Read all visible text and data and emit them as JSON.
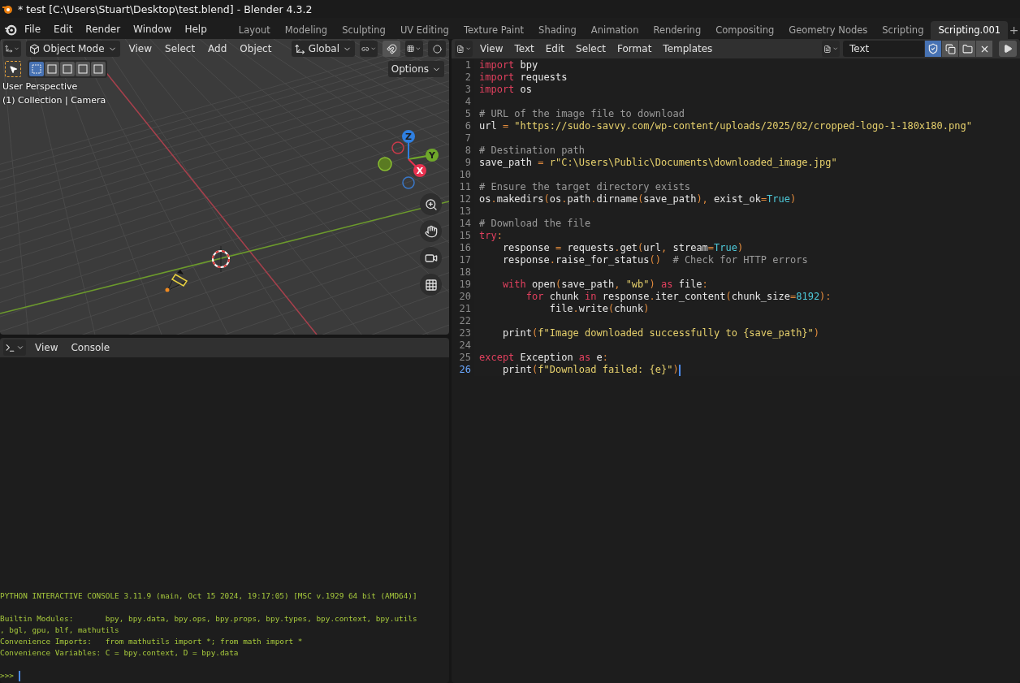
{
  "window": {
    "title": "* test [C:\\Users\\Stuart\\Desktop\\test.blend] - Blender 4.3.2"
  },
  "menu": [
    "File",
    "Edit",
    "Render",
    "Window",
    "Help"
  ],
  "workspace_tabs": [
    {
      "label": "Layout",
      "selected": false
    },
    {
      "label": "Modeling",
      "selected": false
    },
    {
      "label": "Sculpting",
      "selected": false
    },
    {
      "label": "UV Editing",
      "selected": false
    },
    {
      "label": "Texture Paint",
      "selected": false
    },
    {
      "label": "Shading",
      "selected": false
    },
    {
      "label": "Animation",
      "selected": false
    },
    {
      "label": "Rendering",
      "selected": false
    },
    {
      "label": "Compositing",
      "selected": false
    },
    {
      "label": "Geometry Nodes",
      "selected": false
    },
    {
      "label": "Scripting",
      "selected": false
    },
    {
      "label": "Scripting.001",
      "selected": true
    }
  ],
  "add_tab": "+",
  "viewport": {
    "mode": "Object Mode",
    "menus": [
      "View",
      "Select",
      "Add",
      "Object"
    ],
    "orientation": "Global",
    "snap_on": true,
    "select_modes": [
      {
        "selected": true
      },
      {
        "selected": false
      },
      {
        "selected": false
      },
      {
        "selected": false
      },
      {
        "selected": false
      }
    ],
    "options": "Options",
    "overlay": [
      "User Perspective",
      "(1) Collection | Camera"
    ],
    "gizmo": [
      {
        "label": "Z",
        "color": "#2f7fe0"
      },
      {
        "label": "Y",
        "color": "#6fa82a"
      },
      {
        "label": "X",
        "color": "#e8314f"
      }
    ]
  },
  "console": {
    "menus": [
      "View",
      "Console"
    ],
    "blocks": [
      [
        "PYTHON INTERACTIVE CONSOLE 3.11.9 (main, Oct 15 2024, 19:17:05) [MSC v.1929 64 bit (AMD64)]"
      ],
      [
        "Builtin Modules:       bpy, bpy.data, bpy.ops, bpy.props, bpy.types, bpy.context, bpy.utils",
        ", bgl, gpu, blf, mathutils",
        "Convenience Imports:   from mathutils import *; from math import *",
        "Convenience Variables: C = bpy.context, D = bpy.data"
      ]
    ],
    "prompt": ">>>"
  },
  "text_editor": {
    "menus": [
      "View",
      "Text",
      "Edit",
      "Select",
      "Format",
      "Templates"
    ],
    "datablock": "Text",
    "fake_user": true,
    "lines": [
      {
        "number": "1",
        "current": false,
        "tokens": [
          {
            "kind": "keyword",
            "text": "import"
          },
          {
            "kind": "plain",
            "text": " bpy"
          }
        ]
      },
      {
        "number": "2",
        "current": false,
        "tokens": [
          {
            "kind": "keyword",
            "text": "import"
          },
          {
            "kind": "plain",
            "text": " requests"
          }
        ]
      },
      {
        "number": "3",
        "current": false,
        "tokens": [
          {
            "kind": "keyword",
            "text": "import"
          },
          {
            "kind": "plain",
            "text": " os"
          }
        ]
      },
      {
        "number": "4",
        "current": false
      },
      {
        "number": "5",
        "current": false,
        "tokens": [
          {
            "kind": "comment",
            "text": "# URL of the image file to download"
          }
        ]
      },
      {
        "number": "6",
        "current": false,
        "tokens": [
          {
            "kind": "plain",
            "text": "url "
          },
          {
            "kind": "operator",
            "text": "="
          },
          {
            "kind": "string",
            "text": " \"https://sudo-savvy.com/wp-content/uploads/2025/02/cropped-logo-1-180x180.png\""
          }
        ]
      },
      {
        "number": "7",
        "current": false
      },
      {
        "number": "8",
        "current": false,
        "tokens": [
          {
            "kind": "comment",
            "text": "# Destination path"
          }
        ]
      },
      {
        "number": "9",
        "current": false,
        "tokens": [
          {
            "kind": "plain",
            "text": "save_path "
          },
          {
            "kind": "operator",
            "text": "="
          },
          {
            "kind": "string",
            "text": " r\"C:\\Users\\Public\\Documents\\downloaded_image.jpg\""
          }
        ]
      },
      {
        "number": "10",
        "current": false
      },
      {
        "number": "11",
        "current": false,
        "tokens": [
          {
            "kind": "comment",
            "text": "# Ensure the target directory exists"
          }
        ]
      },
      {
        "number": "12",
        "current": false,
        "tokens": [
          {
            "kind": "plain",
            "text": "os"
          },
          {
            "kind": "operator",
            "text": "."
          },
          {
            "kind": "plain",
            "text": "makedirs"
          },
          {
            "kind": "operator",
            "text": "("
          },
          {
            "kind": "plain",
            "text": "os"
          },
          {
            "kind": "operator",
            "text": "."
          },
          {
            "kind": "plain",
            "text": "path"
          },
          {
            "kind": "operator",
            "text": "."
          },
          {
            "kind": "plain",
            "text": "dirname"
          },
          {
            "kind": "operator",
            "text": "("
          },
          {
            "kind": "plain",
            "text": "save_path"
          },
          {
            "kind": "operator",
            "text": "),"
          },
          {
            "kind": "plain",
            "text": " exist_ok"
          },
          {
            "kind": "operator",
            "text": "="
          },
          {
            "kind": "constant",
            "text": "True"
          },
          {
            "kind": "operator",
            "text": ")"
          }
        ]
      },
      {
        "number": "13",
        "current": false
      },
      {
        "number": "14",
        "current": false,
        "tokens": [
          {
            "kind": "comment",
            "text": "# Download the file"
          }
        ]
      },
      {
        "number": "15",
        "current": false,
        "tokens": [
          {
            "kind": "keyword",
            "text": "try"
          },
          {
            "kind": "operator",
            "text": ":"
          }
        ]
      },
      {
        "number": "16",
        "current": false,
        "tokens": [
          {
            "kind": "plain",
            "text": "    response "
          },
          {
            "kind": "operator",
            "text": "="
          },
          {
            "kind": "plain",
            "text": " requests"
          },
          {
            "kind": "operator",
            "text": "."
          },
          {
            "kind": "plain",
            "text": "get"
          },
          {
            "kind": "operator",
            "text": "("
          },
          {
            "kind": "plain",
            "text": "url"
          },
          {
            "kind": "operator",
            "text": ","
          },
          {
            "kind": "plain",
            "text": " stream"
          },
          {
            "kind": "operator",
            "text": "="
          },
          {
            "kind": "constant",
            "text": "True"
          },
          {
            "kind": "operator",
            "text": ")"
          }
        ]
      },
      {
        "number": "17",
        "current": false,
        "tokens": [
          {
            "kind": "plain",
            "text": "    response"
          },
          {
            "kind": "operator",
            "text": "."
          },
          {
            "kind": "plain",
            "text": "raise_for_status"
          },
          {
            "kind": "operator",
            "text": "()"
          },
          {
            "kind": "comment",
            "text": "  # Check for HTTP errors"
          }
        ]
      },
      {
        "number": "18",
        "current": false
      },
      {
        "number": "19",
        "current": false,
        "tokens": [
          {
            "kind": "keyword",
            "text": "    with"
          },
          {
            "kind": "plain",
            "text": " open"
          },
          {
            "kind": "operator",
            "text": "("
          },
          {
            "kind": "plain",
            "text": "save_path"
          },
          {
            "kind": "operator",
            "text": ","
          },
          {
            "kind": "string",
            "text": " \"wb\""
          },
          {
            "kind": "operator",
            "text": ")"
          },
          {
            "kind": "keyword",
            "text": " as"
          },
          {
            "kind": "plain",
            "text": " file"
          },
          {
            "kind": "operator",
            "text": ":"
          }
        ]
      },
      {
        "number": "20",
        "current": false,
        "tokens": [
          {
            "kind": "keyword",
            "text": "        for"
          },
          {
            "kind": "plain",
            "text": " chunk "
          },
          {
            "kind": "keyword",
            "text": "in"
          },
          {
            "kind": "plain",
            "text": " response"
          },
          {
            "kind": "operator",
            "text": "."
          },
          {
            "kind": "plain",
            "text": "iter_content"
          },
          {
            "kind": "operator",
            "text": "("
          },
          {
            "kind": "plain",
            "text": "chunk_size"
          },
          {
            "kind": "operator",
            "text": "="
          },
          {
            "kind": "constant",
            "text": "8192"
          },
          {
            "kind": "operator",
            "text": "):"
          }
        ]
      },
      {
        "number": "21",
        "current": false,
        "tokens": [
          {
            "kind": "plain",
            "text": "            file"
          },
          {
            "kind": "operator",
            "text": "."
          },
          {
            "kind": "plain",
            "text": "write"
          },
          {
            "kind": "operator",
            "text": "("
          },
          {
            "kind": "plain",
            "text": "chunk"
          },
          {
            "kind": "operator",
            "text": ")"
          }
        ]
      },
      {
        "number": "22",
        "current": false
      },
      {
        "number": "23",
        "current": false,
        "tokens": [
          {
            "kind": "plain",
            "text": "    print"
          },
          {
            "kind": "operator",
            "text": "("
          },
          {
            "kind": "string",
            "text": "f\"Image downloaded successfully to {save_path}\""
          },
          {
            "kind": "operator",
            "text": ")"
          }
        ]
      },
      {
        "number": "24",
        "current": false
      },
      {
        "number": "25",
        "current": false,
        "tokens": [
          {
            "kind": "keyword",
            "text": "except"
          },
          {
            "kind": "plain",
            "text": " Exception "
          },
          {
            "kind": "keyword",
            "text": "as"
          },
          {
            "kind": "plain",
            "text": " e"
          },
          {
            "kind": "operator",
            "text": ":"
          }
        ]
      },
      {
        "number": "26",
        "current": true,
        "tokens": [
          {
            "kind": "plain",
            "text": "    print"
          },
          {
            "kind": "operator",
            "text": "("
          },
          {
            "kind": "string",
            "text": "f\"Download failed: {e}\""
          },
          {
            "kind": "operator",
            "text": ")"
          }
        ]
      }
    ]
  }
}
